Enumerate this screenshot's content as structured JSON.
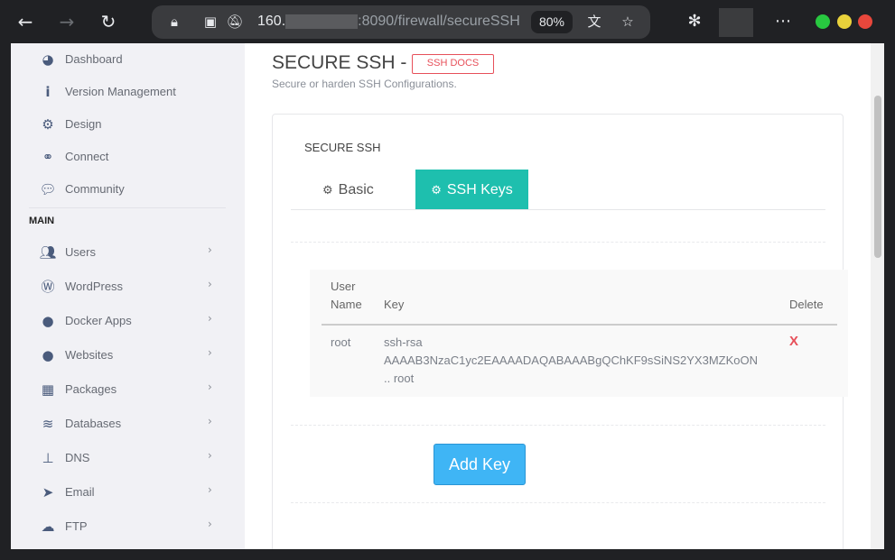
{
  "browser": {
    "url_host": "160.",
    "url_path": ":8090/firewall/secureSSH",
    "zoom": "80%"
  },
  "sidebar": {
    "items_top": [
      {
        "label": "Dashboard",
        "icon": "tachometer-icon"
      },
      {
        "label": "Version Management",
        "icon": "info-icon"
      },
      {
        "label": "Design",
        "icon": "gear-icon"
      },
      {
        "label": "Connect",
        "icon": "link-icon"
      },
      {
        "label": "Community",
        "icon": "comments-icon"
      }
    ],
    "heading": "MAIN",
    "items_main": [
      {
        "label": "Users",
        "icon": "users-icon"
      },
      {
        "label": "WordPress",
        "icon": "wordpress-icon"
      },
      {
        "label": "Docker Apps",
        "icon": "globe-icon"
      },
      {
        "label": "Websites",
        "icon": "globe-icon"
      },
      {
        "label": "Packages",
        "icon": "cubes-icon"
      },
      {
        "label": "Databases",
        "icon": "database-icon"
      },
      {
        "label": "DNS",
        "icon": "sitemap-icon"
      },
      {
        "label": "Email",
        "icon": "paper-plane-icon"
      },
      {
        "label": "FTP",
        "icon": "cloud-upload-icon"
      }
    ]
  },
  "page": {
    "title": "SECURE SSH -",
    "docs_button": "SSH DOCS",
    "subtitle": "Secure or harden SSH Configurations."
  },
  "card": {
    "title": "SECURE SSH",
    "tabs": [
      {
        "label": "Basic",
        "icon": "gear-icon"
      },
      {
        "label": "SSH Keys",
        "icon": "gears-icon"
      }
    ]
  },
  "keys_table": {
    "headers": {
      "user_line1": "User",
      "user_line2": "Name",
      "key": "Key",
      "delete": "Delete"
    },
    "rows": [
      {
        "user": "root",
        "key_line1": "ssh-rsa",
        "key_line2": "AAAAB3NzaC1yc2EAAAADAQABAAABgQChKF9sSiNS2YX3MZKoON",
        "key_line3": ".. root",
        "delete": "X"
      }
    ]
  },
  "add_key_button": "Add Key",
  "colors": {
    "accent_teal": "#1ebfae",
    "danger": "#e7505a",
    "primary_blue": "#3fb5f5"
  }
}
